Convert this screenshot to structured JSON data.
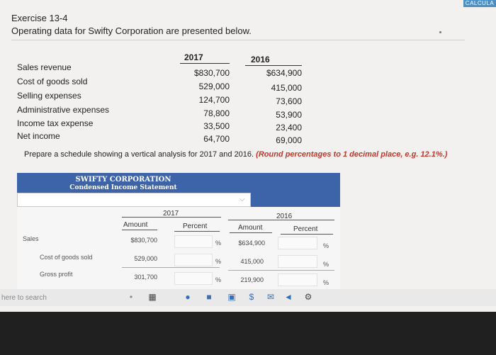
{
  "window": {
    "calc_label": "CALCULA"
  },
  "exercise": {
    "title": "Exercise 13-4",
    "subtitle": "Operating data for Swifty Corporation are presented below."
  },
  "data_table": {
    "year1": "2017",
    "year2": "2016",
    "rows": [
      {
        "label": "Sales revenue",
        "v2017": "$830,700",
        "v2016": "$634,900"
      },
      {
        "label": "Cost of goods sold",
        "v2017": "529,000",
        "v2016": "415,000"
      },
      {
        "label": "Selling expenses",
        "v2017": "124,700",
        "v2016": "73,600"
      },
      {
        "label": "Administrative expenses",
        "v2017": "78,800",
        "v2016": "53,900"
      },
      {
        "label": "Income tax expense",
        "v2017": "33,500",
        "v2016": "23,400"
      },
      {
        "label": "Net income",
        "v2017": "64,700",
        "v2016": "69,000"
      }
    ]
  },
  "instructions": {
    "main": "Prepare a schedule showing a vertical analysis for 2017 and 2016. ",
    "note": "(Round percentages to 1 decimal place, e.g. 12.1%.)"
  },
  "schedule": {
    "company": "SWIFTY CORPORATION",
    "statement": "Condensed Income Statement",
    "year1": "2017",
    "year2": "2016",
    "amount_label": "Amount",
    "percent_label": "Percent",
    "pct_symbol": "%",
    "rows": [
      {
        "label": "Sales",
        "a2017": "$830,700",
        "a2016": "$634,900"
      },
      {
        "label": "Cost of goods sold",
        "a2017": "529,000",
        "a2016": "415,000"
      },
      {
        "label": "Gross profit",
        "a2017": "301,700",
        "a2016": "219,900"
      }
    ]
  },
  "taskbar": {
    "search_placeholder": "here to search"
  },
  "colors": {
    "header_blue": "#3d64a8",
    "note_red": "#c0392b"
  }
}
